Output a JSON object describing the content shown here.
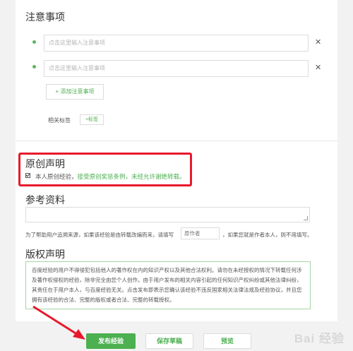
{
  "notes": {
    "title": "注意事项",
    "placeholder": "点击这里输入注意事项",
    "add_label": "+ 添加注意事项",
    "tags_label": "相关标签",
    "tag_button": "+标签"
  },
  "original": {
    "title": "原创声明",
    "checked": true,
    "text_prefix": "本人原创经验，",
    "text_link": "接受原创奖惩条例，未经允许谢绝转载。"
  },
  "reference": {
    "title": "参考资料",
    "help_prefix": "为了帮助用户追溯来源，如果该经验是由转载改编而来，请填写",
    "author_placeholder": "原作者",
    "help_suffix": "，如果您就是作者本人，则不用填写。"
  },
  "copyright": {
    "title": "版权声明",
    "text": "百度经验的用户不得侵犯包括他人的著作权在内的知识产权以及其他合法权利。请勿在未经授权的情况下转载任何涉及著作权侵权的经验，除非完全由您个人创作。由于用户发布的相关内容引起的任何知识产权纠纷或其他法律纠纷，其责任在于用户本人，与百度经验无关。点击发布即表示您确认该经验不违反国家相关法律法规及经验协议，并且您拥有该经验的合法、完整的版权或者合法、完整的转载授权。"
  },
  "footer": {
    "publish": "发布经验",
    "save_draft": "保存草稿",
    "preview": "预览"
  },
  "watermark": "Bai 经验",
  "colors": {
    "accent": "#4caf50",
    "highlight": "#e8192c"
  }
}
